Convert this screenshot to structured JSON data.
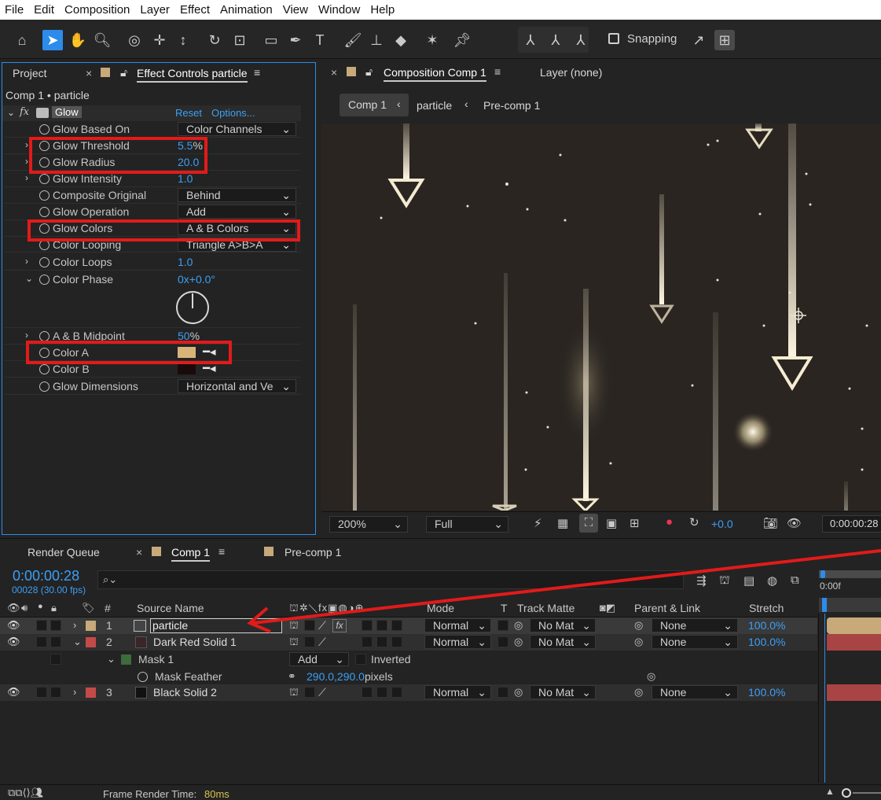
{
  "menu": [
    "File",
    "Edit",
    "Composition",
    "Layer",
    "Effect",
    "Animation",
    "View",
    "Window",
    "Help"
  ],
  "toolbar": {
    "snapping_label": "Snapping"
  },
  "left_panel": {
    "tab_project": "Project",
    "tab_effect_controls": "Effect Controls particle",
    "breadcrumb": "Comp 1 • particle",
    "effect_name": "Glow",
    "reset": "Reset",
    "options": "Options...",
    "props": [
      {
        "label": "Glow Based On",
        "value": "Color Channels"
      },
      {
        "label": "Glow Threshold",
        "value": "5.5",
        "unit": "%"
      },
      {
        "label": "Glow Radius",
        "value": "20.0"
      },
      {
        "label": "Glow Intensity",
        "value": "1.0"
      },
      {
        "label": "Composite Original",
        "value": "Behind"
      },
      {
        "label": "Glow Operation",
        "value": "Add"
      },
      {
        "label": "Glow Colors",
        "value": "A & B Colors"
      },
      {
        "label": "Color Looping",
        "value": "Triangle A>B>A"
      },
      {
        "label": "Color Loops",
        "value": "1.0"
      },
      {
        "label": "Color Phase",
        "value": "0x",
        "value2": "+0.0°"
      },
      {
        "label": "A & B Midpoint",
        "value": "50",
        "unit": "%"
      },
      {
        "label": "Color A",
        "color": "#d9b47a"
      },
      {
        "label": "Color B",
        "color": "#1a0b0b"
      },
      {
        "label": "Glow Dimensions",
        "value": "Horizontal and Ve"
      }
    ]
  },
  "comp_panel": {
    "tab": "Composition Comp 1",
    "layer_tab": "Layer (none)",
    "crumbs": [
      "Comp 1",
      "particle",
      "Pre-comp 1"
    ],
    "zoom": "200%",
    "resolution": "Full",
    "exposure": "+0.0",
    "timecode": "0:00:00:28"
  },
  "timeline": {
    "tab_render": "Render Queue",
    "tab_comp": "Comp 1",
    "tab_precomp": "Pre-comp 1",
    "timecode": "0:00:00:28",
    "frames": "00028 (30.00 fps)",
    "search_placeholder": "",
    "ruler_start": "0:00f",
    "headers": {
      "num": "#",
      "source": "Source Name",
      "mode": "Mode",
      "t": "T",
      "track": "Track Matte",
      "parent": "Parent & Link",
      "stretch": "Stretch"
    },
    "layers": [
      {
        "num": "1",
        "name": "particle",
        "mode": "Normal",
        "matte": "No Mat",
        "parent": "None",
        "stretch": "100.0%",
        "label": "#c7a97a"
      },
      {
        "num": "2",
        "name": "Dark Red Solid 1",
        "mode": "Normal",
        "matte": "No Mat",
        "parent": "None",
        "stretch": "100.0%",
        "label": "#c44a4a"
      },
      {
        "num": "3",
        "name": "Black Solid 2",
        "mode": "Normal",
        "matte": "No Mat",
        "parent": "None",
        "stretch": "100.0%",
        "label": "#c44a4a"
      }
    ],
    "mask": {
      "name": "Mask 1",
      "mode": "Add",
      "inverted": "Inverted",
      "feather_label": "Mask Feather",
      "feather_value": "290.0,290.0",
      "feather_unit": "pixels"
    },
    "status_label": "Frame Render Time:",
    "status_value": "80ms"
  },
  "colors": {
    "accent": "#2d8ceb",
    "value_blue": "#3c9ff5",
    "annotation_red": "#e31a1a"
  }
}
